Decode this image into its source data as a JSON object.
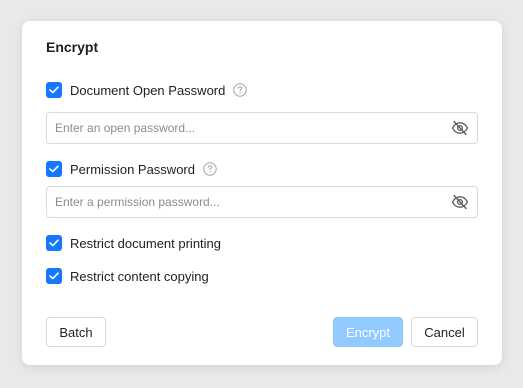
{
  "dialog": {
    "title": "Encrypt",
    "open_password": {
      "checkbox_label": "Document Open Password",
      "checked": true,
      "placeholder": "Enter an open password...",
      "value": ""
    },
    "permission_password": {
      "checkbox_label": "Permission Password",
      "checked": true,
      "placeholder": "Enter a permission password...",
      "value": ""
    },
    "restrict_printing": {
      "label": "Restrict document printing",
      "checked": true
    },
    "restrict_copying": {
      "label": "Restrict content copying",
      "checked": true
    },
    "buttons": {
      "batch": "Batch",
      "encrypt": "Encrypt",
      "cancel": "Cancel"
    }
  },
  "icons": {
    "checkbox": "checkmark-icon",
    "help": "question-circle-icon",
    "visibility": "eye-off-icon"
  },
  "colors": {
    "accent": "#1677ff",
    "accent_disabled": "#91caff",
    "border": "#d9d9d9",
    "text": "#1f1f1f",
    "placeholder": "#8c8c8c"
  }
}
